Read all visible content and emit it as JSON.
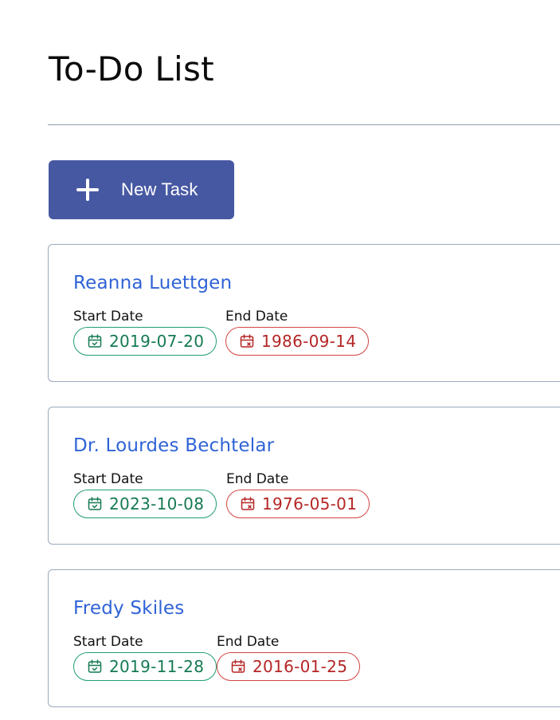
{
  "page": {
    "title": "To-Do List"
  },
  "toolbar": {
    "new_task_label": "New Task",
    "new_task_icon": "plus-icon"
  },
  "labels": {
    "start_date": "Start Date",
    "end_date": "End Date"
  },
  "tasks": [
    {
      "title": "Reanna Luettgen",
      "start_date": "2019-07-20",
      "end_date": "1986-09-14"
    },
    {
      "title": "Dr. Lourdes Bechtelar",
      "start_date": "2023-10-08",
      "end_date": "1976-05-01"
    },
    {
      "title": "Fredy Skiles",
      "start_date": "2019-11-28",
      "end_date": "2016-01-25"
    }
  ],
  "colors": {
    "accent": "#4758a3",
    "title_link": "#2f63d6",
    "start_green": "#157a52",
    "end_red": "#b52525",
    "border": "#9aaabb"
  },
  "icons": {
    "start": "calendar-check-icon",
    "end": "calendar-x-icon"
  }
}
